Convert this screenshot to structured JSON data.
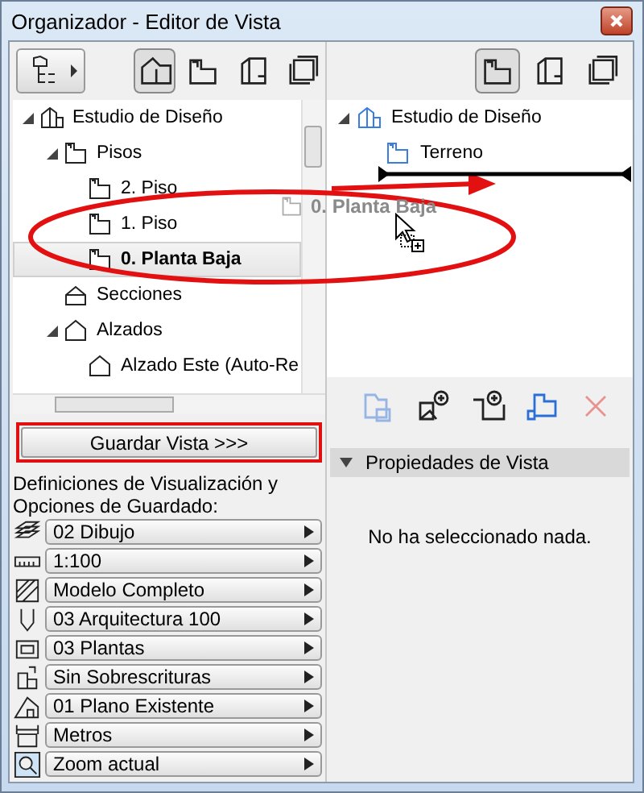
{
  "window": {
    "title": "Organizador - Editor de Vista"
  },
  "left_toolbar": {
    "tabs": [
      {
        "kind": "project",
        "selected": true
      },
      {
        "kind": "floor",
        "selected": false
      },
      {
        "kind": "layout",
        "selected": false
      },
      {
        "kind": "sets",
        "selected": false
      }
    ]
  },
  "left_tree": {
    "items": [
      {
        "label": "Estudio de Diseño",
        "kind": "project",
        "expanded": true,
        "selected": false,
        "children": [
          {
            "label": "Pisos",
            "kind": "floor",
            "expanded": true,
            "selected": false,
            "children": [
              {
                "label": "2. Piso",
                "kind": "floor",
                "selected": false
              },
              {
                "label": "1. Piso",
                "kind": "floor",
                "selected": false
              },
              {
                "label": "0. Planta Baja",
                "kind": "floor",
                "selected": true
              }
            ]
          },
          {
            "label": "Secciones",
            "kind": "section",
            "selected": false
          },
          {
            "label": "Alzados",
            "kind": "elevation",
            "expanded": true,
            "selected": false,
            "children": [
              {
                "label": "Alzado Este (Auto-Re",
                "kind": "elevation",
                "selected": false
              }
            ]
          }
        ]
      }
    ]
  },
  "save_button": {
    "label": "Guardar Vista >>>"
  },
  "options_label": "Definiciones de Visualización y Opciones de Guardado:",
  "options": [
    {
      "kind": "layers",
      "value": "02 Dibujo"
    },
    {
      "kind": "scale",
      "value": "1:100"
    },
    {
      "kind": "model",
      "value": "Modelo Completo"
    },
    {
      "kind": "pen",
      "value": "03 Arquitectura 100"
    },
    {
      "kind": "box",
      "value": "03 Plantas"
    },
    {
      "kind": "override",
      "value": "Sin Sobrescrituras"
    },
    {
      "kind": "renovation",
      "value": "01 Plano Existente"
    },
    {
      "kind": "units",
      "value": "Metros"
    },
    {
      "kind": "zoom",
      "value": "Zoom actual"
    }
  ],
  "right_toolbar": {
    "tabs": [
      {
        "kind": "floor",
        "selected": true
      },
      {
        "kind": "layout",
        "selected": false
      },
      {
        "kind": "sets",
        "selected": false
      }
    ]
  },
  "right_tree": {
    "items": [
      {
        "label": "Estudio de Diseño",
        "kind": "project",
        "expanded": true,
        "children": [
          {
            "label": "Terreno",
            "kind": "floor"
          }
        ]
      }
    ]
  },
  "drag_ghost": {
    "label": "0. Planta Baja"
  },
  "actions": [
    {
      "kind": "folder-list",
      "disabled": true
    },
    {
      "kind": "new-view",
      "disabled": false
    },
    {
      "kind": "new-folder",
      "disabled": false
    },
    {
      "kind": "clone",
      "disabled": false
    },
    {
      "kind": "delete",
      "disabled": true
    }
  ],
  "properties": {
    "title": "Propiedades de Vista",
    "expanded": true,
    "message": "No ha seleccionado nada."
  }
}
